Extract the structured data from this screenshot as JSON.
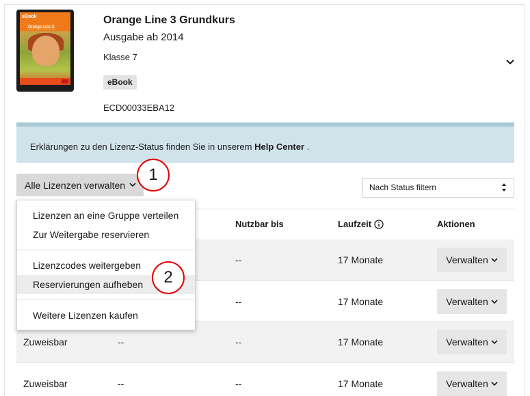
{
  "product": {
    "cover": {
      "tag": "eBook",
      "title": "Orange Line 3"
    },
    "title": "Orange Line 3 Grundkurs",
    "edition": "Ausgabe ab 2014",
    "class": "Klasse 7",
    "badge": "eBook",
    "code": "ECD00033EBA12"
  },
  "info_banner": {
    "text_before": "Erklärungen zu den Lizenz-Status finden Sie in unserem ",
    "link": "Help Center",
    "text_after": " ."
  },
  "controls": {
    "manage_label": "Alle Lizenzen verwalten",
    "status_filter": "Nach Status filtern"
  },
  "table": {
    "headers": {
      "nutzbar": "Nutzbar bis",
      "laufzeit": "Laufzeit",
      "aktionen": "Aktionen"
    },
    "rows": [
      {
        "status": "",
        "col2": "",
        "nutzbar": "--",
        "laufzeit": "17 Monate",
        "action": "Verwalten"
      },
      {
        "status": "",
        "col2": "",
        "nutzbar": "--",
        "laufzeit": "17 Monate",
        "action": "Verwalten"
      },
      {
        "status": "Zuweisbar",
        "col2": "--",
        "nutzbar": "--",
        "laufzeit": "17 Monate",
        "action": "Verwalten"
      },
      {
        "status": "Zuweisbar",
        "col2": "--",
        "nutzbar": "--",
        "laufzeit": "17 Monate",
        "action": "Verwalten"
      }
    ]
  },
  "menu": {
    "items": [
      "Lizenzen an eine Gruppe verteilen",
      "Zur Weitergabe reservieren",
      "Lizenzcodes weitergeben",
      "Reservierungen aufheben",
      "Weitere Lizenzen kaufen"
    ]
  },
  "markers": [
    "1",
    "2"
  ],
  "colors": {
    "banner_bg": "#d1e3ea",
    "banner_border": "#a9c9d6",
    "marker_red": "#e00000",
    "button_gray": "#d9d9d9"
  },
  "icons": {
    "expand": "chevron-down-icon",
    "info": "info-circle-icon",
    "select": "sort-arrows-icon"
  }
}
